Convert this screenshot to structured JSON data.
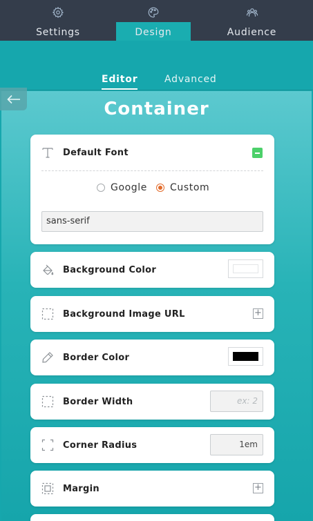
{
  "top_tabs": [
    {
      "label": "Settings",
      "icon": "gear-icon"
    },
    {
      "label": "Design",
      "icon": "palette-icon"
    },
    {
      "label": "Audience",
      "icon": "people-icon"
    }
  ],
  "active_top_tab": "Design",
  "sub_tabs": {
    "editor": "Editor",
    "advanced": "Advanced"
  },
  "page_title": "Container",
  "font_panel": {
    "label": "Default Font",
    "options": {
      "google": "Google",
      "custom": "Custom"
    },
    "selected": "Custom",
    "value": "sans-serif"
  },
  "rows": {
    "background_color": {
      "label": "Background Color",
      "swatch": "#ffffff"
    },
    "background_image": {
      "label": "Background Image URL",
      "plus": "+"
    },
    "border_color": {
      "label": "Border Color",
      "swatch": "#000000"
    },
    "border_width": {
      "label": "Border Width",
      "placeholder": "ex: 2"
    },
    "corner_radius": {
      "label": "Corner Radius",
      "value": "1em"
    },
    "margin": {
      "label": "Margin",
      "plus": "+"
    }
  },
  "colors": {
    "accent": "#1aadb0",
    "topbar": "#343d4b",
    "toggle_green": "#4cd06a",
    "radio_orange": "#e26b2b"
  }
}
